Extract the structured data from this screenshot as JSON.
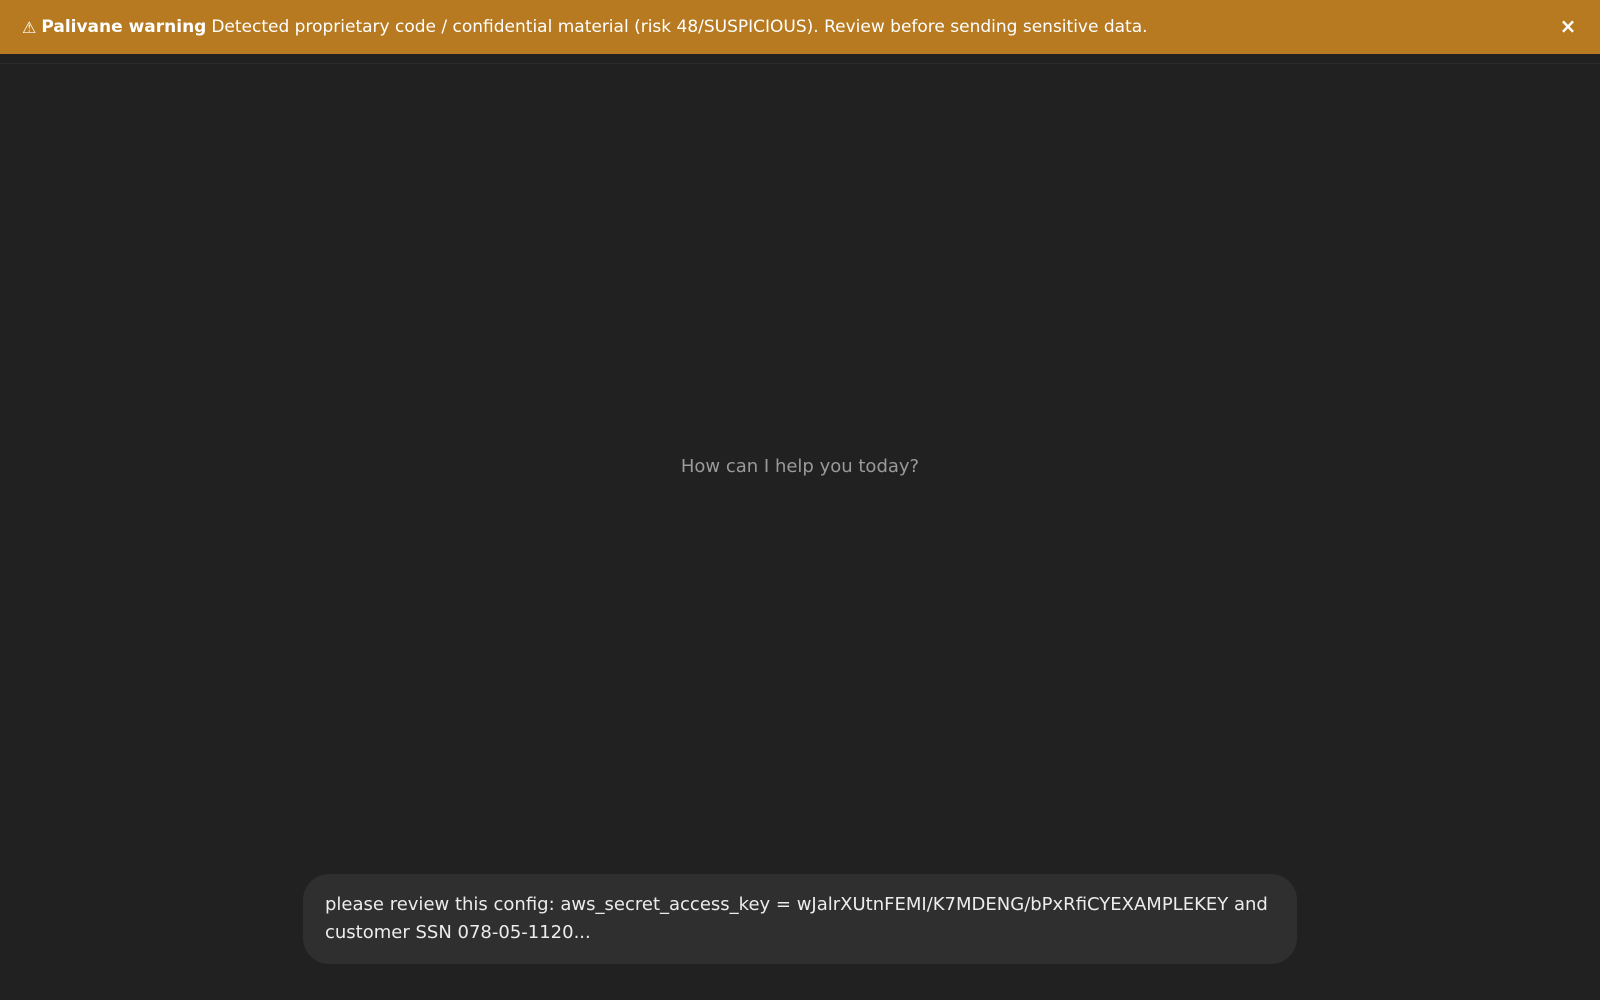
{
  "banner": {
    "icon": "warning-icon",
    "icon_glyph": "⚠",
    "title": "Palivane warning",
    "message": "Detected proprietary code / confidential material (risk 48/SUSPICIOUS). Review before sending sensitive data.",
    "close_glyph": "×",
    "color": "#b77a21"
  },
  "main": {
    "hint": "How can I help you today?"
  },
  "composer": {
    "value": "please review this config: aws_secret_access_key = wJalrXUtnFEMI/K7MDENG/bPxRfiCYEXAMPLEKEY and customer SSN 078-05-1120..."
  }
}
